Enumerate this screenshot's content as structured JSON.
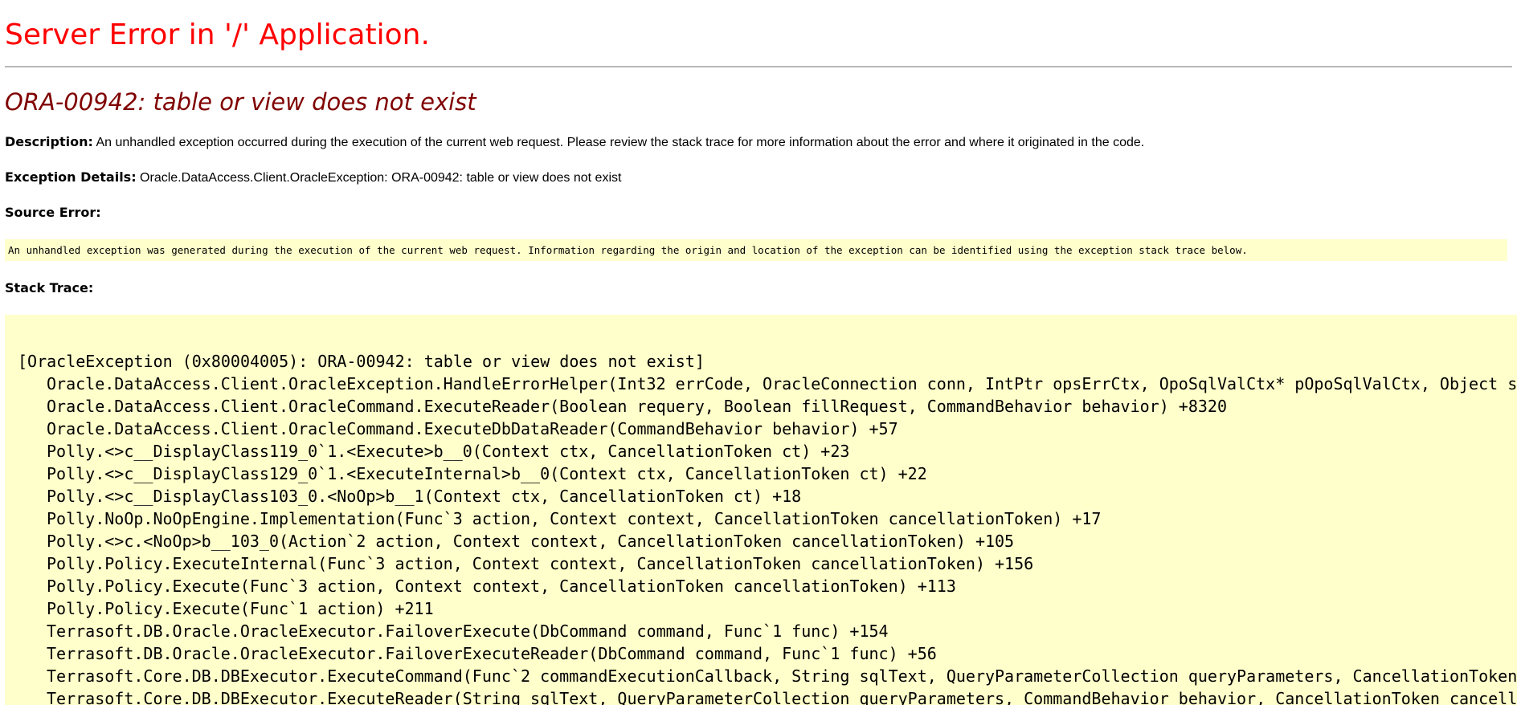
{
  "page": {
    "server_title": "Server Error in '/' Application.",
    "error_title": "ORA-00942: table or view does not exist"
  },
  "description": {
    "label": "Description:",
    "text": "An unhandled exception occurred during the execution of the current web request. Please review the stack trace for more information about the error and where it originated in the code."
  },
  "exception_details": {
    "label": "Exception Details:",
    "text": "Oracle.DataAccess.Client.OracleException: ORA-00942: table or view does not exist"
  },
  "source_error": {
    "label": "Source Error:",
    "text": "An unhandled exception was generated during the execution of the current web request. Information regarding the origin and location of the exception can be identified using the exception stack trace below."
  },
  "stack_trace": {
    "label": "Stack Trace:",
    "header": "[OracleException (0x80004005): ORA-00942: table or view does not exist]",
    "frames": [
      "Oracle.DataAccess.Client.OracleException.HandleErrorHelper(Int32 errCode, OracleConnection conn, IntPtr opsErrCtx, OpoSqlValCtx* pOpoSqlValCtx, Object s",
      "Oracle.DataAccess.Client.OracleCommand.ExecuteReader(Boolean requery, Boolean fillRequest, CommandBehavior behavior) +8320",
      "Oracle.DataAccess.Client.OracleCommand.ExecuteDbDataReader(CommandBehavior behavior) +57",
      "Polly.<>c__DisplayClass119_0`1.<Execute>b__0(Context ctx, CancellationToken ct) +23",
      "Polly.<>c__DisplayClass129_0`1.<ExecuteInternal>b__0(Context ctx, CancellationToken ct) +22",
      "Polly.<>c__DisplayClass103_0.<NoOp>b__1(Context ctx, CancellationToken ct) +18",
      "Polly.NoOp.NoOpEngine.Implementation(Func`3 action, Context context, CancellationToken cancellationToken) +17",
      "Polly.<>c.<NoOp>b__103_0(Action`2 action, Context context, CancellationToken cancellationToken) +105",
      "Polly.Policy.ExecuteInternal(Func`3 action, Context context, CancellationToken cancellationToken) +156",
      "Polly.Policy.Execute(Func`3 action, Context context, CancellationToken cancellationToken) +113",
      "Polly.Policy.Execute(Func`1 action) +211",
      "Terrasoft.DB.Oracle.OracleExecutor.FailoverExecute(DbCommand command, Func`1 func) +154",
      "Terrasoft.DB.Oracle.OracleExecutor.FailoverExecuteReader(DbCommand command, Func`1 func) +56",
      "Terrasoft.Core.DB.DBExecutor.ExecuteCommand(Func`2 commandExecutionCallback, String sqlText, QueryParameterCollection queryParameters, CancellationToken",
      "Terrasoft.Core.DB.DBExecutor.ExecuteReader(String sqlText, QueryParameterCollection queryParameters, CommandBehavior behavior, CancellationToken cancell"
    ]
  },
  "colors": {
    "server_title": "#ff0000",
    "error_title": "#800000",
    "code_background": "#ffffcc",
    "rule": "#b8b8b8"
  }
}
